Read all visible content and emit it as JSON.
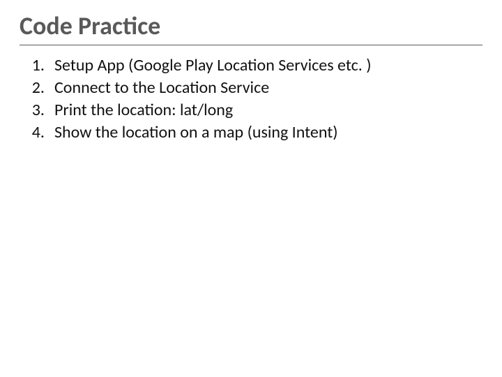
{
  "title": "Code Practice",
  "items": [
    {
      "num": "1.",
      "text": "Setup App (Google Play Location Services etc. )"
    },
    {
      "num": "2.",
      "text": "Connect to the Location Service"
    },
    {
      "num": "3.",
      "text": "Print the location: lat/long"
    },
    {
      "num": "4.",
      "text": "Show the location on a map (using Intent)"
    }
  ]
}
